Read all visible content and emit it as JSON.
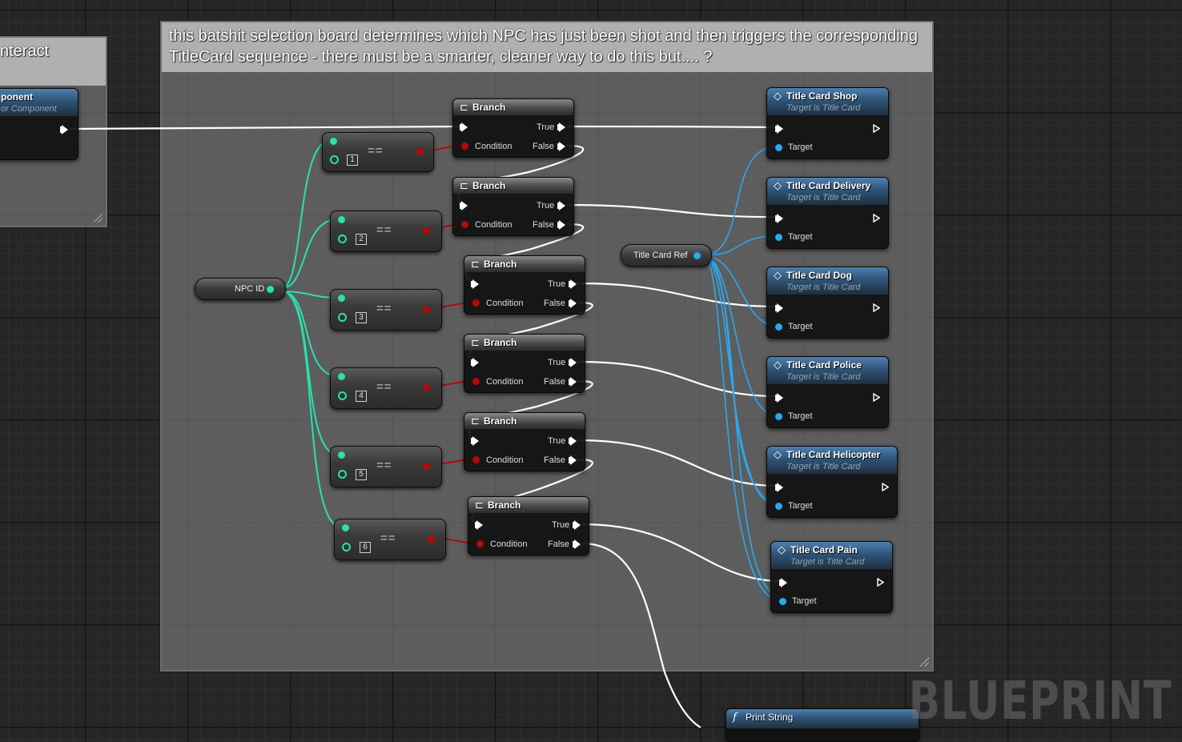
{
  "graph_editor": {
    "left_comment": {
      "title": "nteract"
    },
    "main_comment": {
      "text": "this batshit selection board determines which NPC has just been shot and then triggers the corresponding TitleCard sequence - there must be a smarter, cleaner way to do this but.... ?"
    },
    "partial_node": {
      "title": "ponent",
      "subtitle": "or Component"
    },
    "npc_id_var": {
      "label": "NPC ID"
    },
    "title_card_ref_var": {
      "label": "Title Card Ref"
    },
    "equal_nodes": [
      {
        "symbol": "==",
        "value": "1"
      },
      {
        "symbol": "==",
        "value": "2"
      },
      {
        "symbol": "==",
        "value": "3"
      },
      {
        "symbol": "==",
        "value": "4"
      },
      {
        "symbol": "==",
        "value": "5"
      },
      {
        "symbol": "==",
        "value": "6"
      }
    ],
    "branch_node": {
      "title": "Branch",
      "true_label": "True",
      "false_label": "False",
      "condition_label": "Condition"
    },
    "title_card_nodes": [
      {
        "title": "Title Card Shop",
        "subtitle": "Target is Title Card",
        "target_label": "Target"
      },
      {
        "title": "Title Card Delivery",
        "subtitle": "Target is Title Card",
        "target_label": "Target"
      },
      {
        "title": "Title Card Dog",
        "subtitle": "Target is Title Card",
        "target_label": "Target"
      },
      {
        "title": "Title Card Police",
        "subtitle": "Target is Title Card",
        "target_label": "Target"
      },
      {
        "title": "Title Card Helicopter",
        "subtitle": "Target is Title Card",
        "target_label": "Target"
      },
      {
        "title": "Title Card Pain",
        "subtitle": "Target is Title Card",
        "target_label": "Target"
      }
    ],
    "print_string": {
      "title": "Print String",
      "icon": "function-icon"
    },
    "watermark": "BLUEPRINT",
    "colors": {
      "exec_wire": "#ffffff",
      "int_wire": "#2be0b0",
      "bool_pin": "#b5090a",
      "object_wire": "#2aa8f0",
      "node_header_blue": "#2f5476"
    }
  }
}
